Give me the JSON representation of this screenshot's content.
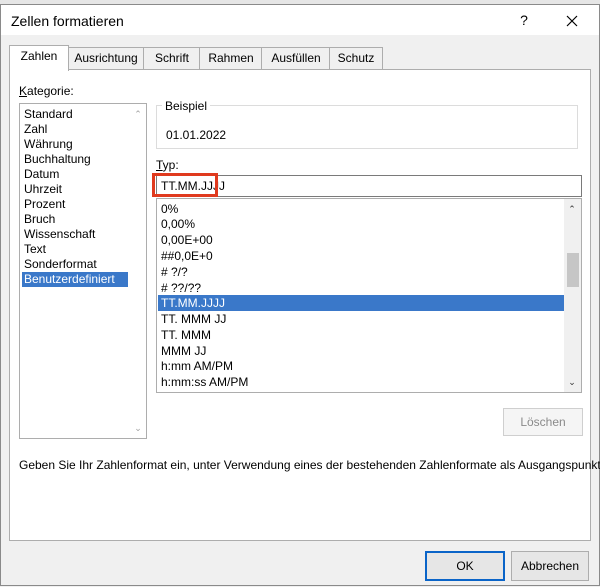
{
  "window": {
    "title": "Zellen formatieren",
    "help": "?",
    "close": "✕"
  },
  "tabs": [
    {
      "label": "Zahlen"
    },
    {
      "label": "Ausrichtung"
    },
    {
      "label": "Schrift"
    },
    {
      "label": "Rahmen"
    },
    {
      "label": "Ausfüllen"
    },
    {
      "label": "Schutz"
    }
  ],
  "category": {
    "label_first": "K",
    "label_rest": "ategorie:",
    "items": [
      "Standard",
      "Zahl",
      "Währung",
      "Buchhaltung",
      "Datum",
      "Uhrzeit",
      "Prozent",
      "Bruch",
      "Wissenschaft",
      "Text",
      "Sonderformat",
      "Benutzerdefiniert"
    ],
    "selected": "Benutzerdefiniert"
  },
  "beispiel": {
    "label": "Beispiel",
    "value": "01.01.2022"
  },
  "type": {
    "label_first": "T",
    "label_rest": "yp:",
    "value": "TT.MM.JJJJ"
  },
  "formats": {
    "items": [
      "0%",
      "0,00%",
      "0,00E+00",
      "##0,0E+0",
      "# ?/?",
      "# ??/??",
      "TT.MM.JJJJ",
      "TT. MMM JJ",
      "TT. MMM",
      "MMM JJ",
      "h:mm AM/PM",
      "h:mm:ss AM/PM"
    ],
    "selected": "TT.MM.JJJJ"
  },
  "buttons": {
    "delete": "Löschen",
    "ok": "OK",
    "cancel": "Abbrechen"
  },
  "hint": "Geben Sie Ihr Zahlenformat ein, unter Verwendung eines der bestehenden Zahlenformate als Ausgangspunkt.",
  "colors": {
    "selection": "#3a78c9",
    "highlight_box": "#e03a1e",
    "ok_border": "#0a64c8"
  }
}
